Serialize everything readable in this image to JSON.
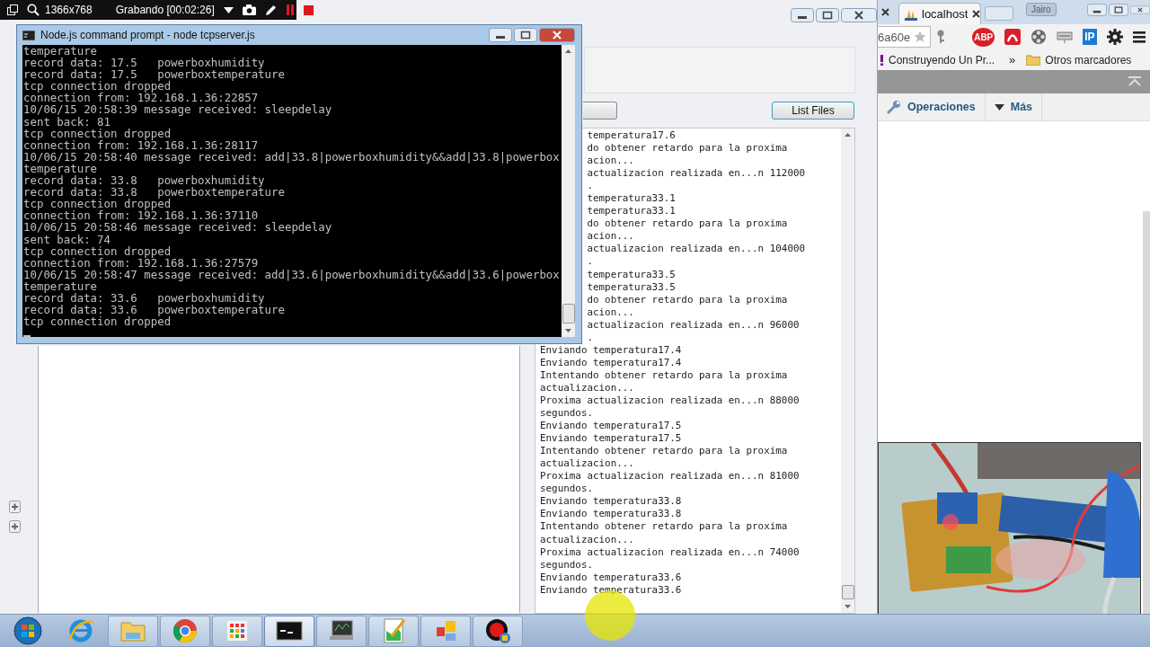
{
  "recorder_bar": {
    "resolution": "1366x768",
    "status": "Grabando [00:02:26]"
  },
  "app_window": {
    "button": "List Files",
    "log_covered": [
      "temperatura17.6",
      "do obtener retardo para la proxima",
      "acion...",
      "actualizacion realizada en...n 112000",
      ".",
      "temperatura33.1",
      "temperatura33.1",
      "do obtener retardo para la proxima",
      "acion...",
      "actualizacion realizada en...n 104000",
      ".",
      "temperatura33.5",
      "temperatura33.5",
      "do obtener retardo para la proxima",
      "acion...",
      "actualizacion realizada en...n 96000",
      "."
    ],
    "log": [
      "Enviando temperatura17.4",
      "Enviando temperatura17.4",
      "Intentando obtener retardo para la proxima",
      "actualizacion...",
      "Proxima actualizacion realizada en...n 88000",
      "segundos.",
      "Enviando temperatura17.5",
      "Enviando temperatura17.5",
      "Intentando obtener retardo para la proxima",
      "actualizacion...",
      "Proxima actualizacion realizada en...n 81000",
      "segundos.",
      "Enviando temperatura33.8",
      "Enviando temperatura33.8",
      "Intentando obtener retardo para la proxima",
      "actualizacion...",
      "Proxima actualizacion realizada en...n 74000",
      "segundos.",
      "Enviando temperatura33.6",
      "Enviando temperatura33.6"
    ]
  },
  "console_window": {
    "title": "Node.js command prompt - node  tcpserver.js",
    "lines": [
      "temperature",
      "record data: 17.5   powerboxhumidity",
      "record data: 17.5   powerboxtemperature",
      "tcp connection dropped",
      "connection from: 192.168.1.36:22857",
      "10/06/15 20:58:39 message received: sleepdelay",
      "sent back: 81",
      "tcp connection dropped",
      "connection from: 192.168.1.36:28117",
      "10/06/15 20:58:40 message received: add|33.8|powerboxhumidity&&add|33.8|powerbox",
      "temperature",
      "record data: 33.8   powerboxhumidity",
      "record data: 33.8   powerboxtemperature",
      "tcp connection dropped",
      "connection from: 192.168.1.36:37110",
      "10/06/15 20:58:46 message received: sleepdelay",
      "sent back: 74",
      "tcp connection dropped",
      "connection from: 192.168.1.36:27579",
      "10/06/15 20:58:47 message received: add|33.6|powerboxhumidity&&add|33.6|powerbox",
      "temperature",
      "record data: 33.6   powerboxhumidity",
      "record data: 33.6   powerboxtemperature",
      "tcp connection dropped"
    ]
  },
  "browser": {
    "tab": "localhost",
    "profile": "Jairo",
    "address": "6a60e",
    "extensions": [
      {
        "kind": "abp",
        "label": "ABP"
      },
      {
        "kind": "avira"
      },
      {
        "kind": "film"
      },
      {
        "kind": "meter"
      },
      {
        "kind": "ip",
        "label": "IP"
      },
      {
        "kind": "gear"
      },
      {
        "kind": "menu"
      }
    ],
    "bookmarks": [
      {
        "kind": "page",
        "label": "Construyendo Un Pr..."
      },
      {
        "kind": "more",
        "label": "»"
      },
      {
        "kind": "folder",
        "label": "Otros marcadores"
      }
    ],
    "page_tabs": [
      {
        "kind": "wrench",
        "label": "Operaciones"
      },
      {
        "kind": "dropdown",
        "label": "Más"
      }
    ]
  },
  "taskbar": {
    "items": [
      {
        "kind": "start",
        "open": false,
        "selected": false
      },
      {
        "kind": "ie",
        "open": false,
        "selected": false
      },
      {
        "kind": "folder",
        "open": true,
        "selected": false
      },
      {
        "kind": "chrome",
        "open": true,
        "selected": false
      },
      {
        "kind": "apps",
        "open": true,
        "selected": false
      },
      {
        "kind": "cmd",
        "open": true,
        "selected": true
      },
      {
        "kind": "monitor",
        "open": true,
        "selected": false
      },
      {
        "kind": "chart",
        "open": true,
        "selected": false
      },
      {
        "kind": "tiles",
        "open": true,
        "selected": false
      },
      {
        "kind": "record",
        "open": true,
        "selected": false
      }
    ]
  }
}
